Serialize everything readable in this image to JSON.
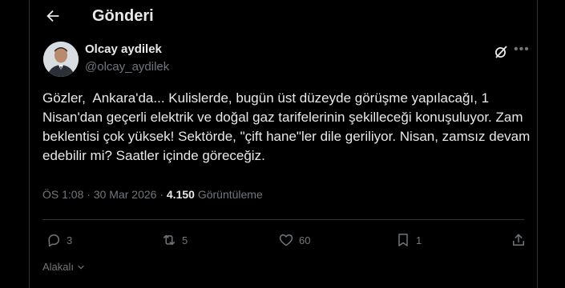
{
  "header": {
    "title": "Gönderi",
    "back_icon": "arrow-left-icon"
  },
  "author": {
    "name": "Olcay aydilek",
    "handle": "@olcay_aydilek"
  },
  "post": {
    "text": "Gözler,  Ankara'da... Kulislerde, bugün üst düzeyde görüşme yapılacağı, 1 Nisan'dan geçerli elektrik ve doğal gaz tarifelerinin şekilleceği konuşuluyor. Zam beklentisi çok yüksek! Sektörde, \"çift hane\"ler dile geriliyor. Nisan, zamsız devam edebilir mi? Saatler içinde göreceğiz.",
    "time": "ÖS 1:08",
    "separator": "·",
    "date": "30 Mar 2026",
    "views_count": "4.150",
    "views_label": "Görüntüleme"
  },
  "actions": {
    "replies": "3",
    "reposts": "5",
    "likes": "60",
    "bookmarks": "1"
  },
  "footer": {
    "language_label": "Alakalı"
  },
  "colors": {
    "background": "#000000",
    "text": "#e7e9ea",
    "muted": "#71767b",
    "border": "#2f3336"
  }
}
